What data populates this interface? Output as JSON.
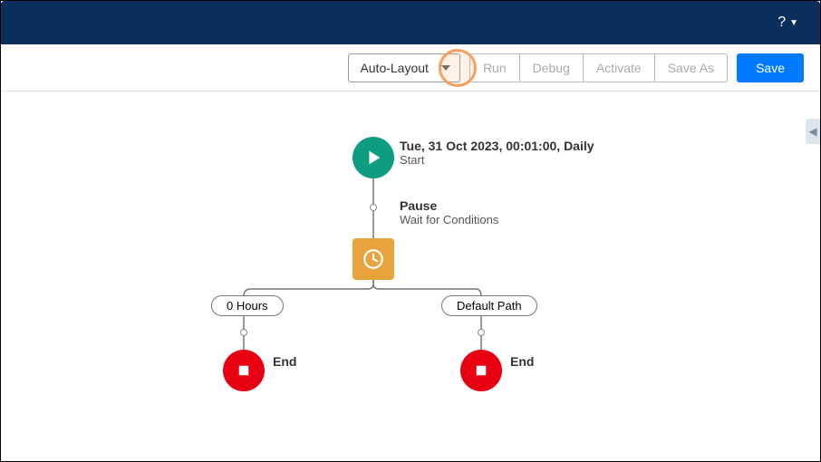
{
  "header": {
    "help_label": "?"
  },
  "toolbar": {
    "layout_dropdown": "Auto-Layout",
    "run": "Run",
    "debug": "Debug",
    "activate": "Activate",
    "save_as": "Save As",
    "save": "Save"
  },
  "flow": {
    "start": {
      "title": "Tue, 31 Oct 2023, 00:01:00, Daily",
      "sub": "Start"
    },
    "pause": {
      "title": "Pause",
      "sub": "Wait for Conditions"
    },
    "branch_left": "0 Hours",
    "branch_right": "Default Path",
    "end_left": "End",
    "end_right": "End"
  }
}
